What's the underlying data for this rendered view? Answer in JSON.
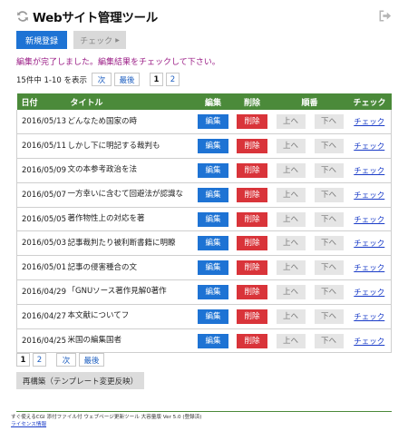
{
  "header": {
    "title": "Webサイト管理ツール"
  },
  "toolbar": {
    "new_label": "新規登録",
    "check_label": "チェック"
  },
  "notice": "編集が完了しました。編集結果をチェックして下さい。",
  "pager": {
    "summary": "15件中 1-10 を表示",
    "next": "次",
    "last": "最後",
    "pages": [
      "1",
      "2"
    ]
  },
  "table": {
    "headers": {
      "date": "日付",
      "title": "タイトル",
      "edit": "編集",
      "delete": "削除",
      "order": "順番",
      "check": "チェック"
    },
    "rows": [
      {
        "date": "2016/05/13",
        "title": "どんなため国家の時"
      },
      {
        "date": "2016/05/11",
        "title": "しかし下に明記する裁判も"
      },
      {
        "date": "2016/05/09",
        "title": "文の本参考政治を法"
      },
      {
        "date": "2016/05/07",
        "title": "一方幸いに含むて回避法が認識な"
      },
      {
        "date": "2016/05/05",
        "title": "著作物性上の対応を著"
      },
      {
        "date": "2016/05/03",
        "title": "記事裁判たり被利断書籍に明瞭"
      },
      {
        "date": "2016/05/01",
        "title": "記事の侵害種合の文"
      },
      {
        "date": "2016/04/29",
        "title": "「GNUソース著作見解0著作"
      },
      {
        "date": "2016/04/27",
        "title": "本文献についてフ"
      },
      {
        "date": "2016/04/25",
        "title": "米国の編集国者"
      }
    ],
    "labels": {
      "edit": "編集",
      "delete": "削除",
      "up": "上へ",
      "down": "下へ",
      "check": "チェック"
    }
  },
  "rebuild_label": "再構築（テンプレート変更反映）",
  "footer": {
    "line1": "すぐ使えるCGI 添付ファイル付 ウェブページ更新ツール 大容量版 Ver 5.0 (登録済)",
    "link": "ライセンス情報"
  },
  "colors": {
    "accent": "#1e73d4",
    "danger": "#d9343a",
    "table_header": "#4b8a3a",
    "notice": "#9b1d86"
  }
}
